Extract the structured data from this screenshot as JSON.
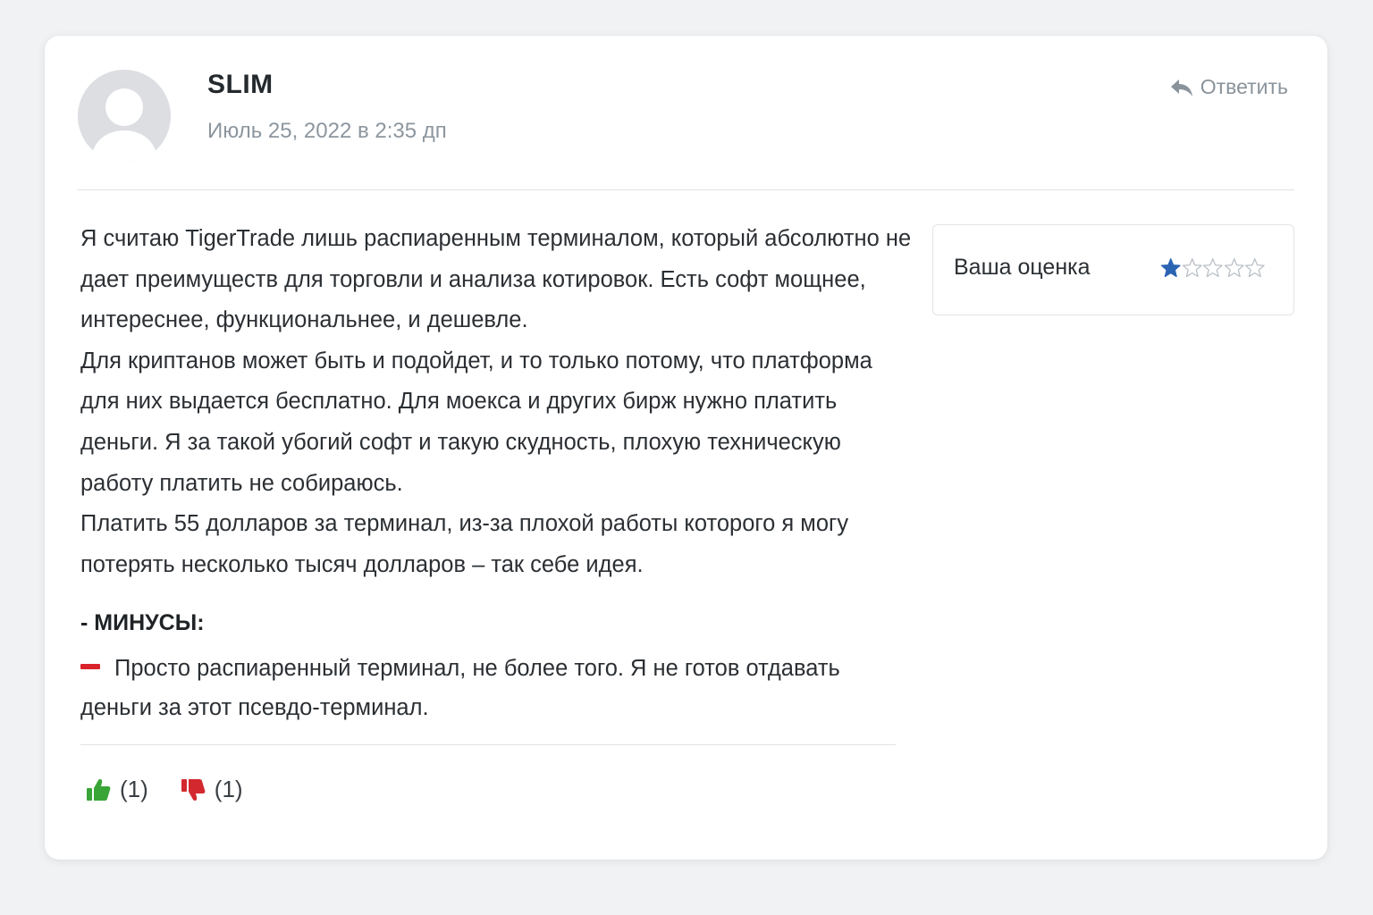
{
  "comment": {
    "author": "SLIM",
    "date": "Июль 25, 2022 в 2:35 дп",
    "reply_label": "Ответить",
    "paragraphs": [
      "Я считаю TigerTrade лишь распиаренным терминалом, который абсолютно не дает преимуществ для торговли и анализа котировок. Есть софт мощнее, интереснее, функциональнее, и дешевле.",
      "Для криптанов может быть и подойдет, и то только потому, что платформа для них выдается бесплатно. Для моекса и других бирж нужно платить деньги. Я за такой убогий софт и такую скудность, плохую техническую работу платить не собираюсь.",
      "Платить 55 долларов за терминал, из-за плохой работы которого я могу потерять несколько тысяч долларов – так себе идея."
    ],
    "minus_heading": "- МИНУСЫ:",
    "minus_text": "Просто распиаренный терминал, не более того. Я не готов отдавать деньги за этот псевдо-терминал.",
    "likes": "(1)",
    "dislikes": "(1)"
  },
  "rating": {
    "label": "Ваша оценка",
    "value": 1,
    "max": 5
  },
  "colors": {
    "background": "#f0f2f4",
    "card": "#ffffff",
    "muted_text": "#8d969e",
    "star_filled": "#2c64b4",
    "star_empty": "#b9bfc6",
    "minus_accent": "#d9232b",
    "like": "#3aa537",
    "dislike": "#d3282e"
  },
  "icons": {
    "reply": "reply-arrow-icon",
    "like": "thumbs-up-icon",
    "dislike": "thumbs-down-icon",
    "avatar": "default-avatar-icon",
    "star": "star-icon"
  }
}
